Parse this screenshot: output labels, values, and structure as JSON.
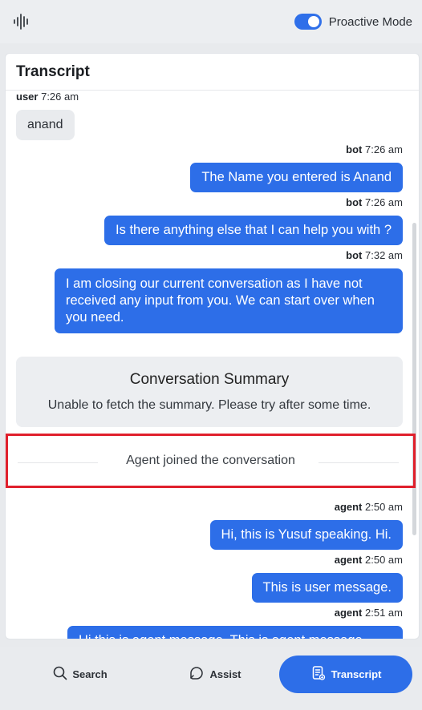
{
  "topbar": {
    "logo_icon": "waveform-icon",
    "toggle_label": "Proactive Mode",
    "toggle_on": true,
    "accent": "#2f6fe9"
  },
  "transcript": {
    "title": "Transcript",
    "messages": [
      {
        "sender": "user",
        "time": "7:26 am",
        "text": "anand"
      },
      {
        "sender": "bot",
        "time": "7:26 am",
        "text": "The Name you entered is Anand"
      },
      {
        "sender": "bot",
        "time": "7:26 am",
        "text": "Is there anything else that I can help you with ?"
      },
      {
        "sender": "bot",
        "time": "7:32 am",
        "text": "I am closing our current conversation as I have not received any input from you. We can start over when you need."
      },
      {
        "sender": "agent",
        "time": "2:50 am",
        "text": "Hi, this is Yusuf speaking. Hi."
      },
      {
        "sender": "agent",
        "time": "2:50 am",
        "text": "This is user message."
      },
      {
        "sender": "agent",
        "time": "2:51 am",
        "text": "Hi this is agent message. This is agent message."
      }
    ],
    "summary": {
      "title": "Conversation Summary",
      "text": "Unable to fetch the summary. Please try after some time."
    },
    "system_event": "Agent joined the conversation"
  },
  "nav": {
    "search_label": "Search",
    "assist_label": "Assist",
    "transcript_label": "Transcript",
    "active": "Transcript"
  }
}
